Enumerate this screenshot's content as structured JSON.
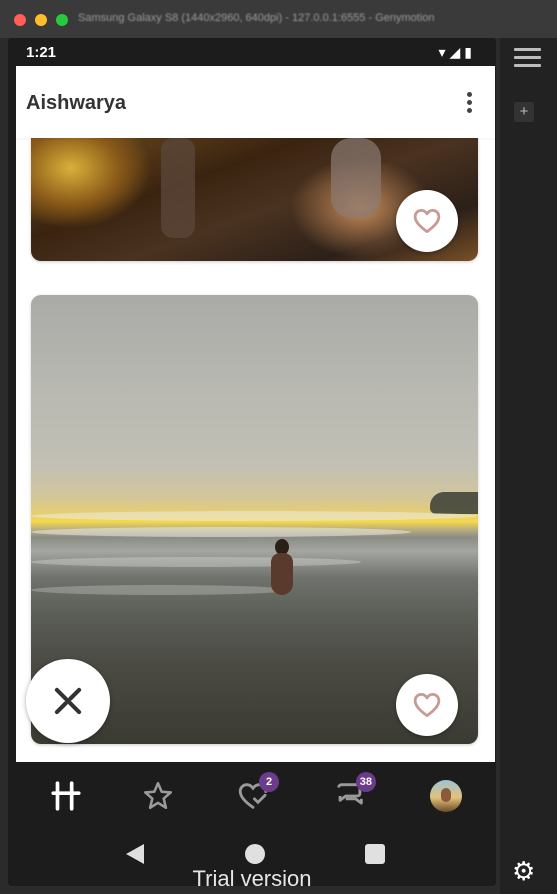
{
  "window": {
    "title": "Samsung Galaxy S8 (1440x2960, 640dpi) - 127.0.0.1:6555 - Genymotion"
  },
  "status_bar": {
    "time": "1:21",
    "icons": [
      "wifi-icon",
      "signal-icon",
      "battery-icon"
    ]
  },
  "app_bar": {
    "title": "Aishwarya",
    "menu_icon": "more-vertical-icon"
  },
  "cards": [
    {
      "kind": "photo",
      "like_icon": "heart-outline-icon"
    },
    {
      "kind": "photo",
      "like_icon": "heart-outline-icon"
    }
  ],
  "reject_button": {
    "icon": "close-x-icon"
  },
  "bottom_nav": {
    "items": [
      {
        "name": "discover",
        "icon": "hinge-logo-icon"
      },
      {
        "name": "standouts",
        "icon": "star-outline-icon"
      },
      {
        "name": "likes",
        "icon": "heart-check-icon",
        "badge": "2"
      },
      {
        "name": "matches",
        "icon": "chat-bubbles-icon",
        "badge": "38"
      },
      {
        "name": "profile",
        "icon": "avatar-icon"
      }
    ]
  },
  "system_nav": [
    "back-icon",
    "home-icon",
    "recents-icon"
  ],
  "watermark": "Trial version",
  "colors": {
    "accent_badge": "#6d3b8c",
    "heart_stroke": "#c89a94",
    "nav_bg": "#1c1c1c"
  }
}
